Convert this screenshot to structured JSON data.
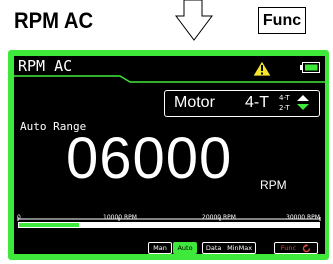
{
  "caption": "RPM AC",
  "func_key": "Func",
  "screen": {
    "title": "RPM AC",
    "range": "Auto Range",
    "reading": "06000",
    "unit": "RPM",
    "motor": {
      "label": "Motor",
      "mode": "4-T",
      "options": [
        "4-T",
        "2-T"
      ]
    },
    "scale": {
      "ticks": [
        "0",
        "10000 RPM",
        "20000 RPM",
        "30000 RPM"
      ],
      "bar_fraction": 0.2
    },
    "buttons": {
      "man": "Man",
      "auto": "Auto",
      "data": "Data",
      "minmax": "MinMax",
      "func": "Func"
    }
  },
  "colors": {
    "accent": "#3fe93b",
    "screen_bg": "#000000",
    "warning": "#f5e62a",
    "func_red": "#e0463a"
  },
  "icons": [
    "arrow-down-icon",
    "warning-icon",
    "battery-icon",
    "toggle-arrows-icon",
    "func-rotate-icon"
  ]
}
